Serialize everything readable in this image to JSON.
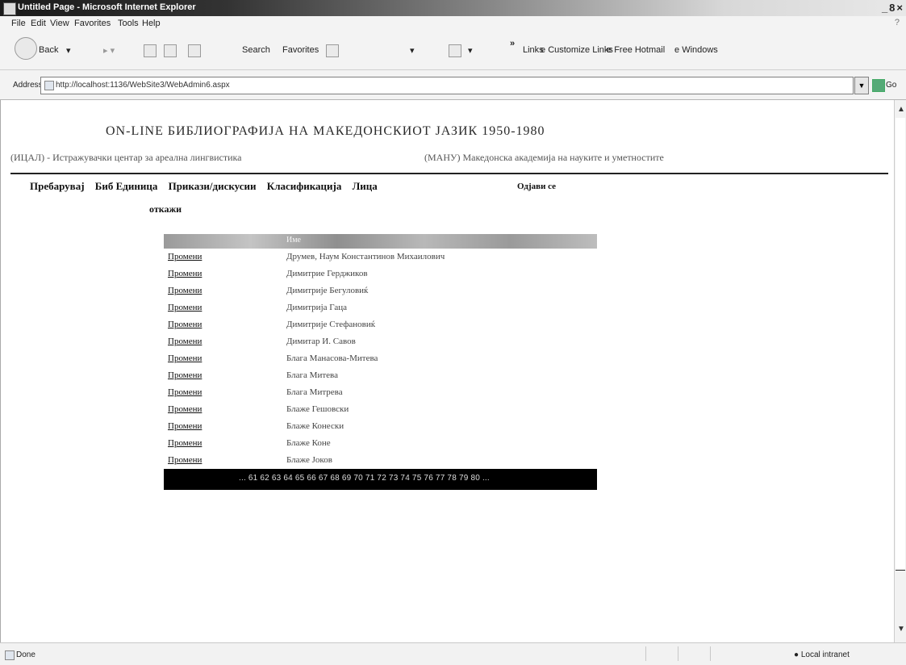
{
  "window": {
    "title": "Untitled Page - Microsoft Internet Explorer",
    "controls": [
      "_",
      "8",
      "×"
    ]
  },
  "menu": [
    "File",
    "Edit",
    "View",
    "Favorites",
    "Tools",
    "Help"
  ],
  "toolbar": {
    "back": "Back",
    "search": "Search",
    "favorites": "Favorites",
    "links_chevron": "»",
    "links": "Links",
    "customize_links": "Customize Links",
    "free_hotmail": "Free Hotmail",
    "windows": "Windows"
  },
  "address": {
    "label": "Address",
    "url": "http://localhost:1136/WebSite3/WebAdmin6.aspx",
    "go": "Go"
  },
  "page": {
    "title": "ON-LINE БИБЛИОГРАФИЈА НА МАКЕДОНСКИОТ ЈАЗИК 1950-1980",
    "subtitle_left": "(ИЦАЛ) - Истражувачки центар за ареална лингвистика",
    "subtitle_right": "(МАНУ) Македонска академија на науките и уметностите",
    "nav": [
      "Пребарувај",
      "Биб Единица",
      "Прикази/дискусии",
      "Класификација",
      "Лица"
    ],
    "nav_logout": "Одјави се",
    "nav_cancel": "откажи"
  },
  "grid": {
    "header": "Име",
    "edit_label": "Промени",
    "rows": [
      "Друмев, Наум Константинов Михаилович",
      "Димитрие Герджиков",
      "Димитрије Бегуловиќ",
      "Димитрија Гаца",
      "Димитрије Стефановиќ",
      "Димитар И. Савов",
      "Блага Манасова-Митева",
      "Блага Митева",
      "Блага Митрева",
      "Блаже Гешовски",
      "Блаже Конески",
      "Блаже Коне",
      "Блаже Јоков"
    ],
    "pager": "... 61 62 63 64 65 66 67 68 69 70 71 72 73 74 75 76 77 78 79 80 ..."
  },
  "status": {
    "done": "Done",
    "zone": "Local intranet"
  }
}
